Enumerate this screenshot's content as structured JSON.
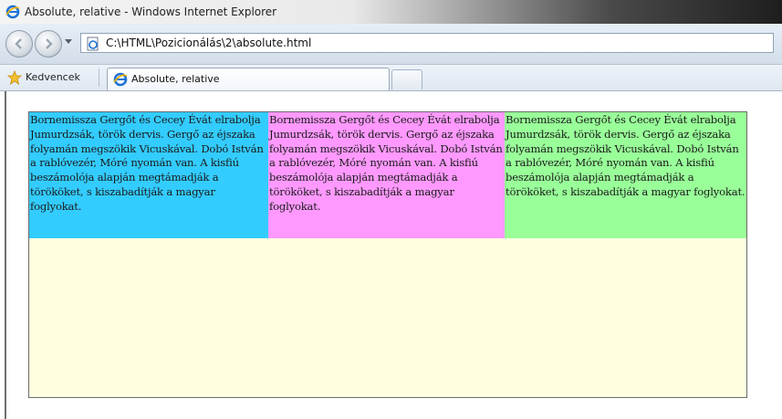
{
  "window": {
    "title": "Absolute, relative - Windows Internet Explorer",
    "icon": "ie-icon"
  },
  "addressbar": {
    "url": "C:\\HTML\\Pozicionálás\\2\\absolute.html"
  },
  "favorites": {
    "label": "Kedvencek"
  },
  "tabs": [
    {
      "label": "Absolute, relative"
    }
  ],
  "colors": {
    "container": "#ffffe0",
    "box_blue": "#33ccff",
    "box_pink": "#ff99ff",
    "box_green": "#99ff99"
  },
  "page": {
    "boxes": [
      {
        "text": "Bornemissza Gergőt és Cecey Évát elrabolja Jumurdzsák, török dervis. Gergő az éjszaka folyamán megszökik Vicuskával. Dobó István a rablóvezér, Móré nyomán van. A kisfiú beszámolója alapján megtámadják a törököket, s kiszabadítják a magyar foglyokat."
      },
      {
        "text": "Bornemissza Gergőt és Cecey Évát elrabolja Jumurdzsák, török dervis. Gergő az éjszaka folyamán megszökik Vicuskával. Dobó István a rablóvezér, Móré nyomán van. A kisfiú beszámolója alapján megtámadják a törököket, s kiszabadítják a magyar foglyokat."
      },
      {
        "text": "Bornemissza Gergőt és Cecey Évát elrabolja Jumurdzsák, török dervis. Gergő az éjszaka folyamán megszökik Vicuskával. Dobó István a rablóvezér, Móré nyomán van. A kisfiú beszámolója alapján megtámadják a törököket, s kiszabadítják a magyar foglyokat."
      }
    ]
  }
}
